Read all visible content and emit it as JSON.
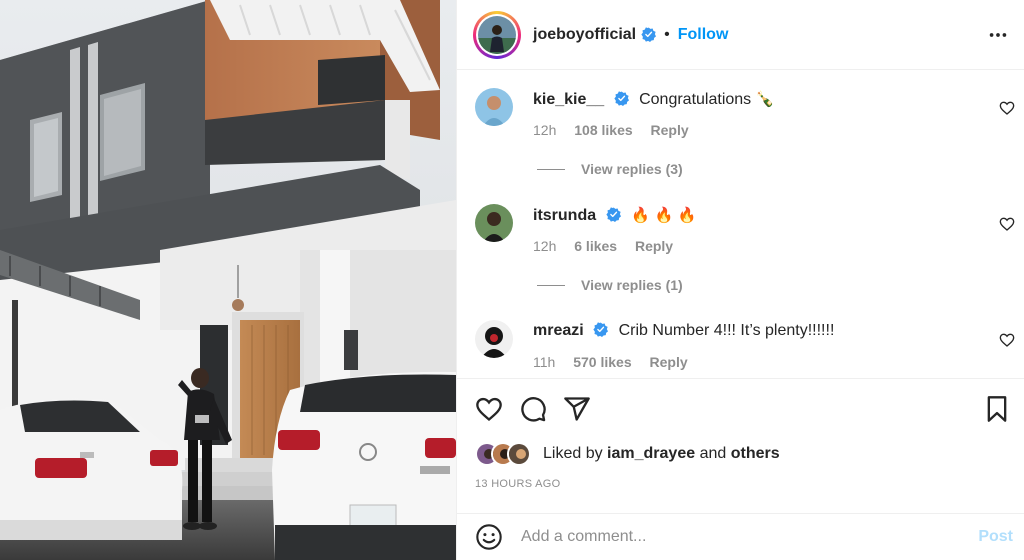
{
  "post": {
    "author": {
      "username": "joeboyofficial",
      "verified": true,
      "follow_label": "Follow",
      "separator": "•"
    },
    "more_icon": "more-horizontal-icon"
  },
  "comments": [
    {
      "username": "kie_kie__",
      "verified": true,
      "text": "Congratulations",
      "emoji": "🍾",
      "time": "12h",
      "likes": "108 likes",
      "reply_label": "Reply",
      "view_replies": "View replies (3)"
    },
    {
      "username": "itsrunda",
      "verified": true,
      "text": "",
      "emoji": "🔥 🔥 🔥",
      "time": "12h",
      "likes": "6 likes",
      "reply_label": "Reply",
      "view_replies": "View replies (1)"
    },
    {
      "username": "mreazi",
      "verified": true,
      "text": "Crib Number 4!!! It’s plenty!!!!!!",
      "emoji": "",
      "time": "11h",
      "likes": "570 likes",
      "reply_label": "Reply",
      "view_replies": ""
    }
  ],
  "actions": {
    "like_icon": "heart-icon",
    "comment_icon": "comment-icon",
    "share_icon": "send-icon",
    "save_icon": "bookmark-icon"
  },
  "likes_summary": {
    "prefix": "Liked by",
    "user": "iam_drayee",
    "and": "and",
    "others": "others"
  },
  "timestamp": "13 HOURS AGO",
  "composer": {
    "placeholder": "Add a comment...",
    "post_label": "Post",
    "emoji_icon": "smiley-icon"
  },
  "colors": {
    "accent": "#0095f6",
    "verified": "#3897f0",
    "muted": "#8e8e8e",
    "post_disabled": "#b2dffc"
  }
}
